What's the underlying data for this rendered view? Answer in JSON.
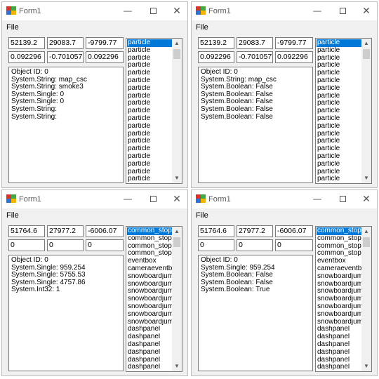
{
  "windows": [
    {
      "title": "Form1",
      "menu_file": "File",
      "row1": [
        "52139.2",
        "29083.7",
        "-9799.77"
      ],
      "row2": [
        "0.092296",
        "-0.701057",
        "0.092296"
      ],
      "textbox_lines": [
        "Object ID: 0",
        "System.String: map_csc",
        "System.String: smoke3",
        "System.Single: 0",
        "System.Single: 0",
        "System.String:",
        "System.String:"
      ],
      "list_items": [
        "particle",
        "particle",
        "particle",
        "particle",
        "particle",
        "particle",
        "particle",
        "particle",
        "particle",
        "particle",
        "particle",
        "particle",
        "particle",
        "particle",
        "particle",
        "particle",
        "particle",
        "particle",
        "particle"
      ],
      "selected_index": 0
    },
    {
      "title": "Form1",
      "menu_file": "File",
      "row1": [
        "52139.2",
        "29083.7",
        "-9799.77"
      ],
      "row2": [
        "0.092296",
        "-0.701057",
        "0.092296"
      ],
      "textbox_lines": [
        "Object ID: 0",
        "System.String: map_csc",
        "System.Boolean: False",
        "System.Boolean: False",
        "System.Boolean: False",
        "System.Boolean: False",
        "System.Boolean: False"
      ],
      "list_items": [
        "particle",
        "particle",
        "particle",
        "particle",
        "particle",
        "particle",
        "particle",
        "particle",
        "particle",
        "particle",
        "particle",
        "particle",
        "particle",
        "particle",
        "particle",
        "particle",
        "particle",
        "particle",
        "particle"
      ],
      "selected_index": 0
    },
    {
      "title": "Form1",
      "menu_file": "File",
      "row1": [
        "51764.6",
        "27977.2",
        "-6006.07"
      ],
      "row2": [
        "0",
        "0",
        "0"
      ],
      "textbox_lines": [
        "Object ID: 0",
        "System.Single: 959.254",
        "System.Single: 5755.53",
        "System.Single: 4757.86",
        "System.Int32: 1"
      ],
      "list_items": [
        "common_stopp",
        "common_stoppl",
        "common_stoppl",
        "common_stoppl",
        "eventbox",
        "cameraeventbo",
        "snowboardjump",
        "snowboardjump",
        "snowboardjump",
        "snowboardjump",
        "snowboardjump",
        "snowboardjump",
        "snowboardjump",
        "dashpanel",
        "dashpanel",
        "dashpanel",
        "dashpanel",
        "dashpanel",
        "dashpanel"
      ],
      "selected_index": 0
    },
    {
      "title": "Form1",
      "menu_file": "File",
      "row1": [
        "51764.6",
        "27977.2",
        "-6006.07"
      ],
      "row2": [
        "0",
        "0",
        "0"
      ],
      "textbox_lines": [
        "Object ID: 0",
        "System.Single: 959.254",
        "System.Boolean: False",
        "System.Boolean: False",
        "System.Boolean: True"
      ],
      "list_items": [
        "common_stopp",
        "common_stoppl",
        "common_stoppl",
        "common_stoppl",
        "eventbox",
        "cameraeventbo",
        "snowboardjump",
        "snowboardjump",
        "snowboardjump",
        "snowboardjump",
        "snowboardjump",
        "snowboardjump",
        "snowboardjump",
        "dashpanel",
        "dashpanel",
        "dashpanel",
        "dashpanel",
        "dashpanel",
        "dashpanel"
      ],
      "selected_index": 0
    }
  ],
  "icons": {
    "minimize": "—",
    "close": "✕",
    "scroll_up": "▲",
    "scroll_down": "▼"
  },
  "colors": {
    "selection": "#0078d7",
    "window_bg": "#f0f0f0",
    "titlebar_bg": "#ffffff"
  }
}
